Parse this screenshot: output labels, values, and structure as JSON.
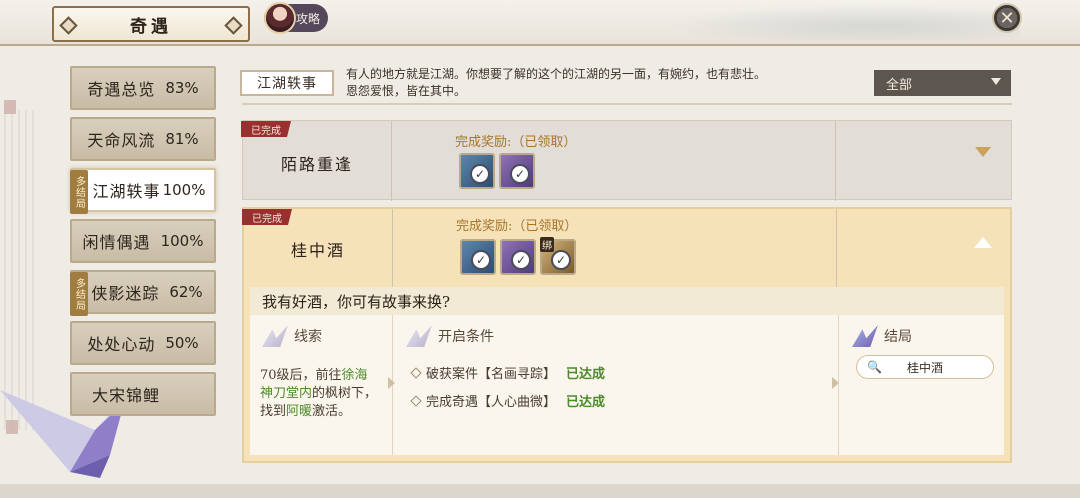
{
  "header": {
    "title": "奇遇",
    "guide_label": "攻略",
    "close_label": "✕"
  },
  "sidebar": {
    "items": [
      {
        "label": "奇遇总览",
        "pct": "83%",
        "multi": ""
      },
      {
        "label": "天命风流",
        "pct": "81%",
        "multi": ""
      },
      {
        "label": "江湖轶事",
        "pct": "100%",
        "multi": "多结局",
        "active": true
      },
      {
        "label": "闲情偶遇",
        "pct": "100%",
        "multi": ""
      },
      {
        "label": "侠影迷踪",
        "pct": "62%",
        "multi": "多结局"
      },
      {
        "label": "处处心动",
        "pct": "50%",
        "multi": ""
      },
      {
        "label": "大宋锦鲤",
        "pct": "",
        "multi": ""
      }
    ]
  },
  "category": {
    "name": "江湖轶事",
    "description": "有人的地方就是江湖。你想要了解的这个的江湖的另一面，有婉约，也有悲壮。恩怨爱恨，皆在其中。"
  },
  "filter": {
    "selected": "全部"
  },
  "rows": [
    {
      "status": "已完成",
      "name": "陌路重逢",
      "reward_label": "完成奖励:（已领取）",
      "icons": [
        "blue",
        "purple"
      ],
      "expanded": false
    },
    {
      "status": "已完成",
      "name": "桂中酒",
      "reward_label": "完成奖励:（已领取）",
      "icons": [
        "blue",
        "purple",
        "gold"
      ],
      "bind_tag": "绑",
      "expanded": true,
      "quote": "我有好酒，你可有故事来换?",
      "clue_title": "线索",
      "clue": {
        "p1": "70级后，前往",
        "h1": "徐海神刀堂内",
        "p2": "的枫树下，找到",
        "h2": "阿暖",
        "p3": "激活。"
      },
      "cond_title": "开启条件",
      "conditions": [
        {
          "text": "破获案件【名画寻踪】",
          "state": "已达成"
        },
        {
          "text": "完成奇遇【人心曲微】",
          "state": "已达成"
        }
      ],
      "ending_title": "结局",
      "ending": "桂中酒"
    }
  ],
  "icons": {
    "check": "✓",
    "search": "🔍",
    "close": "close-icon"
  }
}
